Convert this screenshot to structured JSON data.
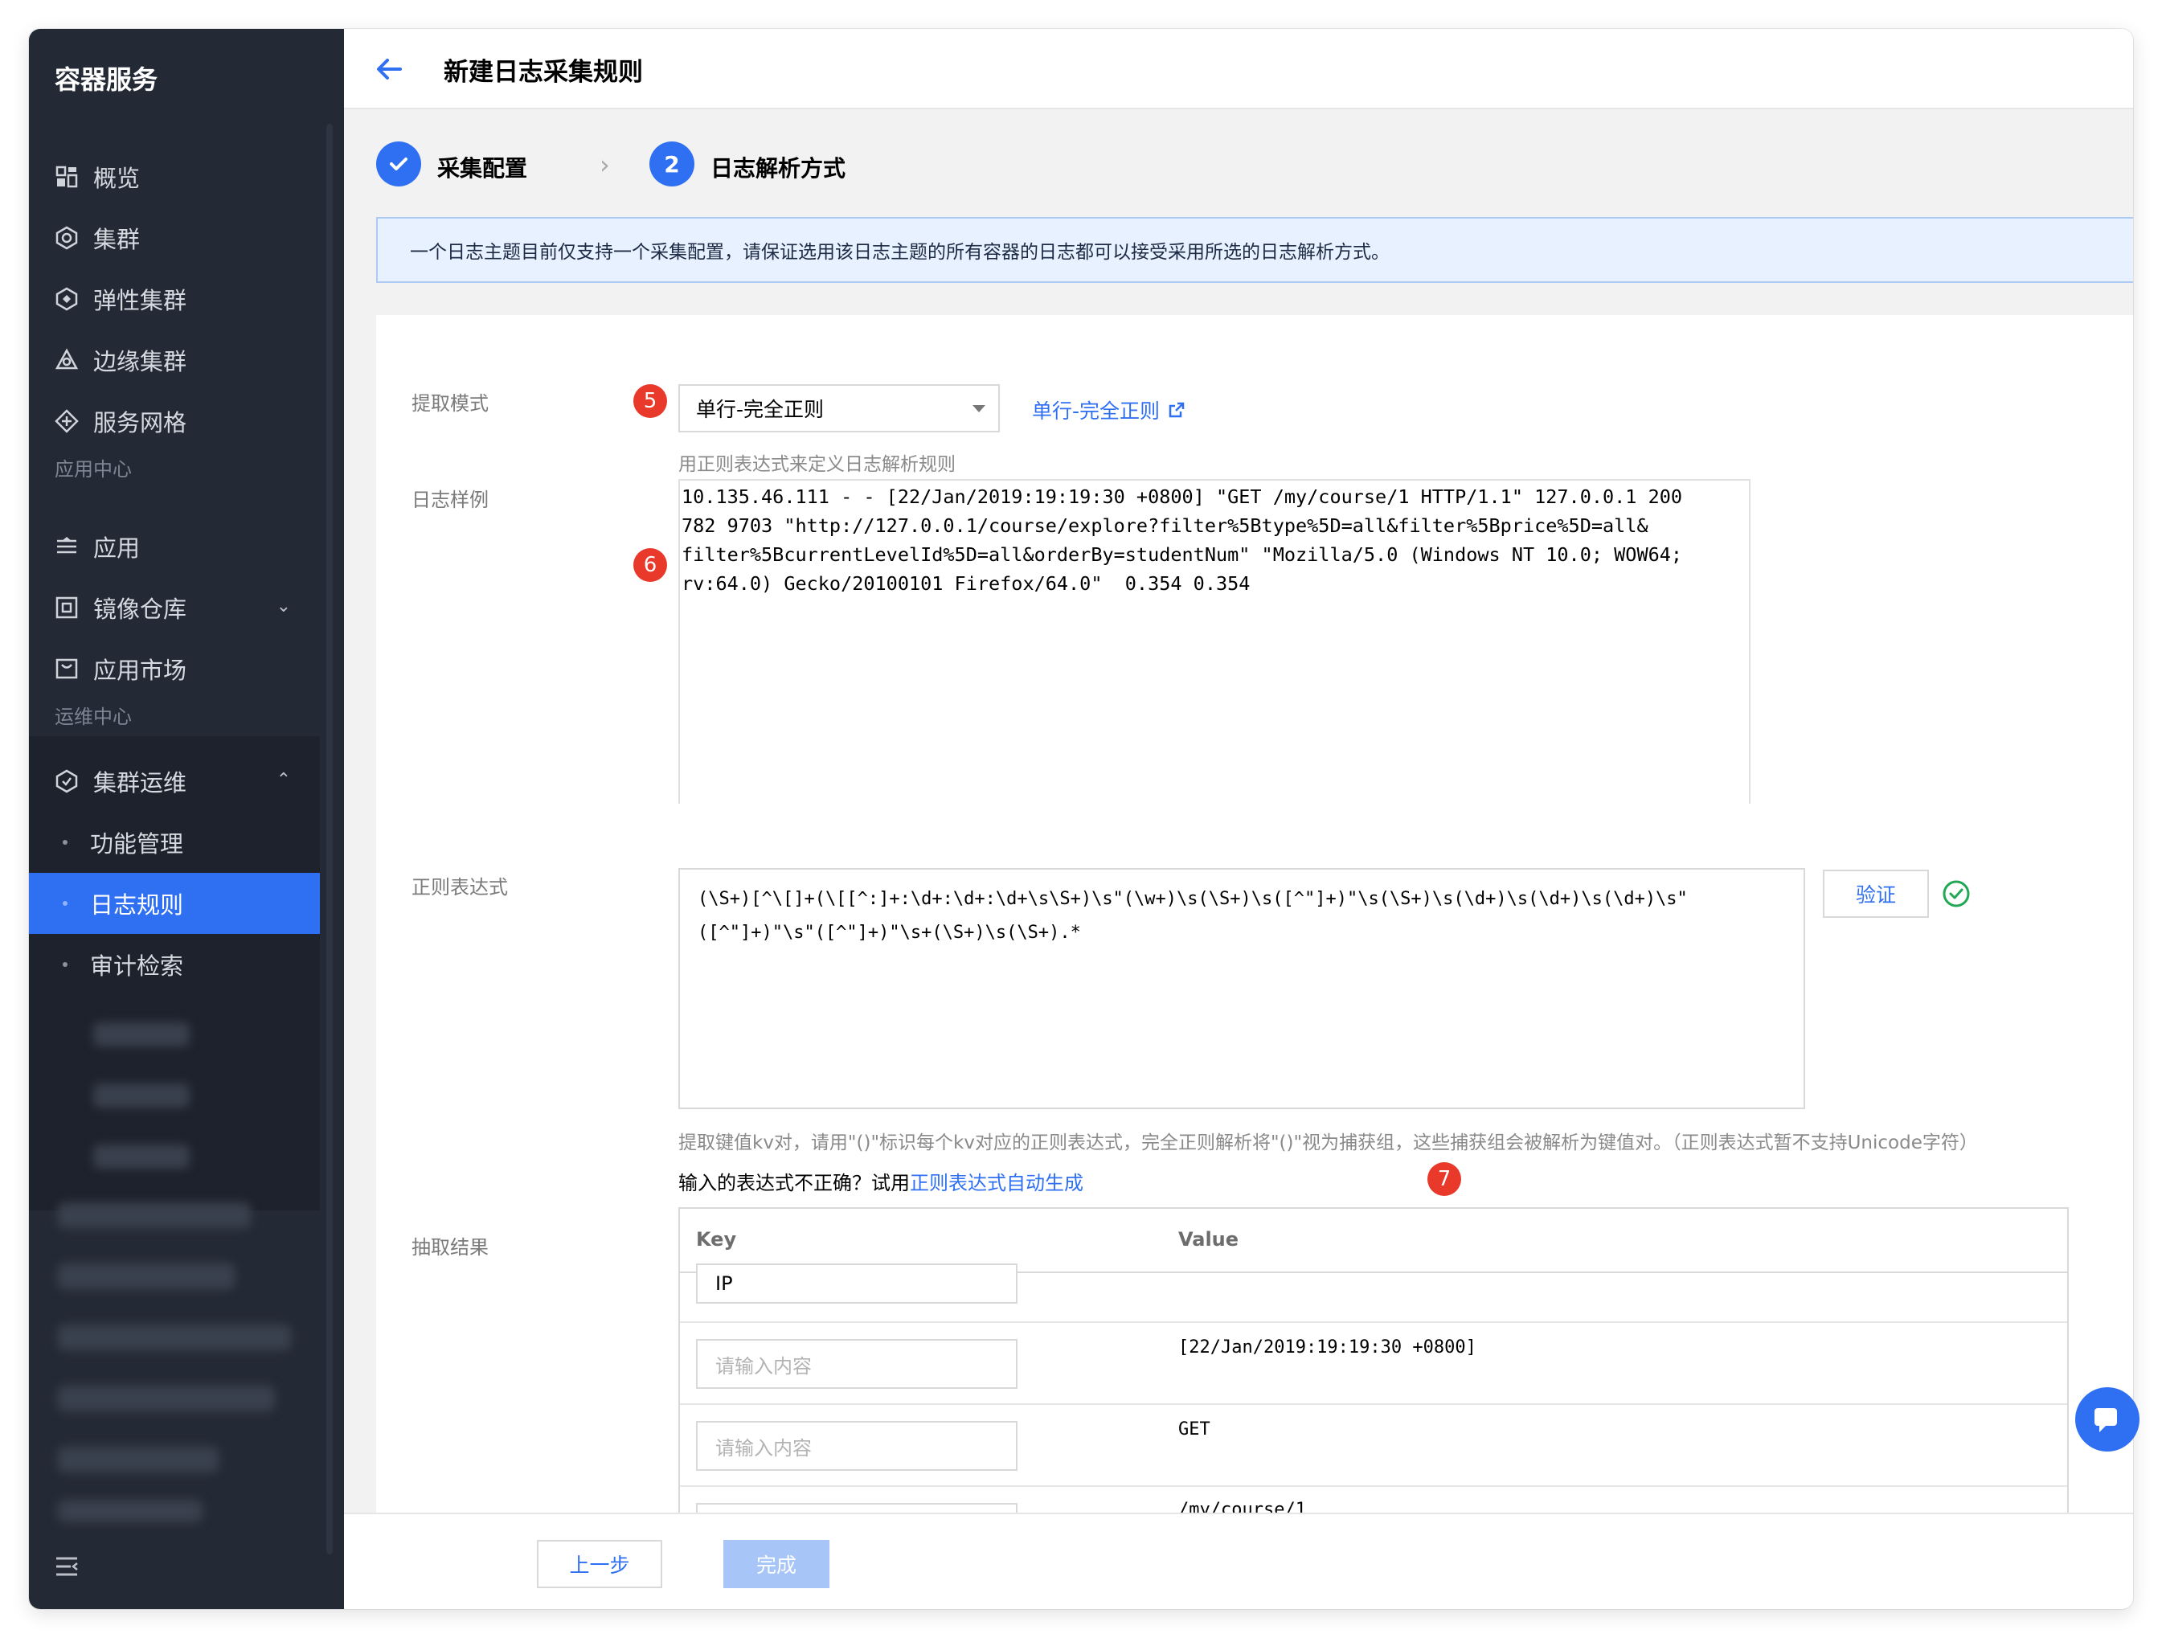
{
  "app": {
    "brand": "容器服务",
    "page_title": "新建日志采集规则"
  },
  "sidebar": {
    "items": [
      {
        "label": "概览",
        "icon": "dashboard-icon"
      },
      {
        "label": "集群",
        "icon": "cluster-icon"
      },
      {
        "label": "弹性集群",
        "icon": "elastic-cluster-icon"
      },
      {
        "label": "边缘集群",
        "icon": "edge-cluster-icon"
      },
      {
        "label": "服务网格",
        "icon": "service-mesh-icon"
      }
    ],
    "section_app": "应用中心",
    "app_items": [
      {
        "label": "应用",
        "icon": "app-icon"
      },
      {
        "label": "镜像仓库",
        "icon": "image-repo-icon"
      },
      {
        "label": "应用市场",
        "icon": "app-market-icon"
      }
    ],
    "section_ops": "运维中心",
    "ops_group": {
      "label": "集群运维",
      "icon": "cluster-ops-icon"
    },
    "ops_items": [
      {
        "label": "功能管理"
      },
      {
        "label": "日志规则",
        "active": true
      },
      {
        "label": "审计检索"
      }
    ]
  },
  "steps": [
    {
      "label": "采集配置",
      "state": "done"
    },
    {
      "number": "2",
      "label": "日志解析方式",
      "state": "current"
    }
  ],
  "notice": "一个日志主题目前仅支持一个采集配置，请保证选用该日志主题的所有容器的日志都可以接受采用所选的日志解析方式。",
  "form": {
    "extract_mode": {
      "label": "提取模式",
      "badge": "5",
      "value": "单行-完全正则",
      "doc_link": "单行-完全正则",
      "help": "用正则表达式来定义日志解析规则"
    },
    "log_sample": {
      "label": "日志样例",
      "badge": "6",
      "value": "10.135.46.111 - - [22/Jan/2019:19:19:30 +0800] \"GET /my/course/1 HTTP/1.1\" 127.0.0.1 200\n782 9703 \"http://127.0.0.1/course/explore?filter%5Btype%5D=all&filter%5Bprice%5D=all&\nfilter%5BcurrentLevelId%5D=all&orderBy=studentNum\" \"Mozilla/5.0 (Windows NT 10.0; WOW64;\nrv:64.0) Gecko/20100101 Firefox/64.0\"  0.354 0.354"
    },
    "regex": {
      "label": "正则表达式",
      "value": "(\\S+)[^\\[]+(\\[[^:]+:\\d+:\\d+:\\d+\\s\\S+)\\s\"(\\w+)\\s(\\S+)\\s([^\"]+)\"\\s(\\S+)\\s(\\d+)\\s(\\d+)\\s(\\d+)\\s\"\n([^\"]+)\"\\s\"([^\"]+)\"\\s+(\\S+)\\s(\\S+).*",
      "verify_button": "验证",
      "help": "提取键值kv对，请用\"()\"标识每个kv对应的正则表达式，完全正则解析将\"()\"视为捕获组，这些捕获组会被解析为键值对。（正则表达式暂不支持Unicode字符）",
      "hint_prefix": "输入的表达式不正确？试用",
      "hint_link": "正则表达式自动生成",
      "badge": "7"
    },
    "result": {
      "label": "抽取结果",
      "col_key": "Key",
      "col_value": "Value",
      "placeholder": "请输入内容",
      "rows": [
        {
          "key": "IP",
          "value": ""
        },
        {
          "key": "",
          "value": "[22/Jan/2019:19:19:30 +0800]"
        },
        {
          "key": "",
          "value": "GET"
        },
        {
          "key": "",
          "value": "/my/course/1"
        }
      ]
    }
  },
  "footer": {
    "prev": "上一步",
    "done": "完成"
  },
  "colors": {
    "primary": "#2f6ff2",
    "sidebar_bg": "#242a35",
    "badge": "#e8392a",
    "success": "#21a854"
  }
}
